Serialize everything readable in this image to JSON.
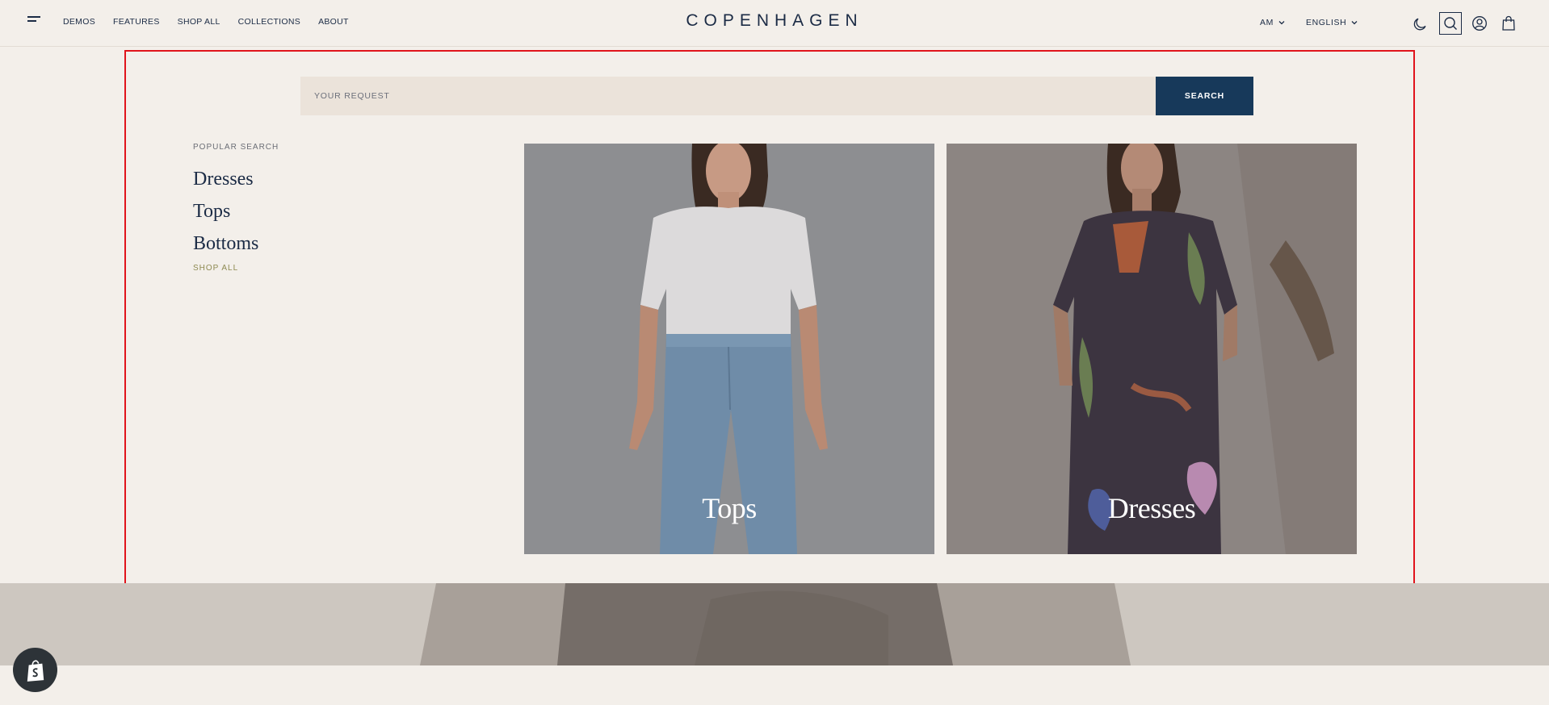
{
  "header": {
    "nav": [
      "DEMOS",
      "FEATURES",
      "SHOP ALL",
      "COLLECTIONS",
      "ABOUT"
    ],
    "logo": "COPENHAGEN",
    "currency": "AM",
    "language": "ENGLISH"
  },
  "search": {
    "placeholder": "YOUR REQUEST",
    "button": "SEARCH"
  },
  "popular": {
    "title": "POPULAR SEARCH",
    "items": [
      "Dresses",
      "Tops",
      "Bottoms"
    ],
    "shop_all": "SHOP ALL"
  },
  "cards": [
    {
      "label": "Tops"
    },
    {
      "label": "Dresses"
    }
  ],
  "colors": {
    "accent": "#17395a",
    "highlight_border": "#e0141c",
    "background": "#f3efea"
  }
}
